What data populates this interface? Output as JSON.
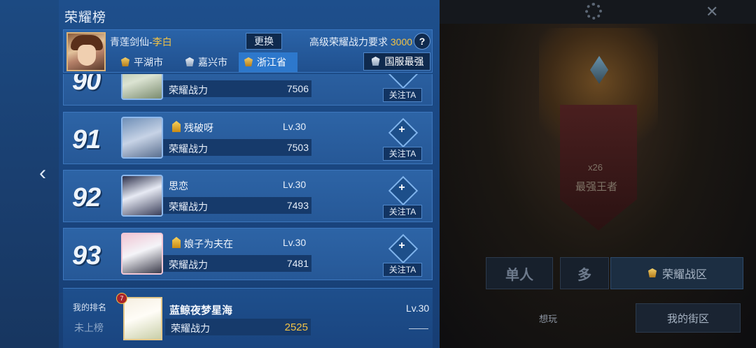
{
  "panel": {
    "title": "荣耀榜"
  },
  "header": {
    "hero_name_prefix": "青莲剑仙-",
    "hero_name_highlight": "李白",
    "swap_label": "更换",
    "requirement_label": "高级荣耀战力要求",
    "requirement_value": "3000",
    "help_label": "?",
    "tabs": [
      {
        "label": "平湖市"
      },
      {
        "label": "嘉兴市"
      },
      {
        "label": "浙江省"
      }
    ],
    "server_label": "国服最强"
  },
  "rows": [
    {
      "rank": "90",
      "name": "",
      "level": "",
      "power_label": "荣耀战力",
      "power": "7506",
      "follow_label": "关注TA"
    },
    {
      "rank": "91",
      "name": "残破呀",
      "level": "Lv.30",
      "power_label": "荣耀战力",
      "power": "7503",
      "follow_label": "关注TA"
    },
    {
      "rank": "92",
      "name": "思恋",
      "level": "Lv.30",
      "power_label": "荣耀战力",
      "power": "7493",
      "follow_label": "关注TA"
    },
    {
      "rank": "93",
      "name": "娘子为夫在",
      "level": "Lv.30",
      "power_label": "荣耀战力",
      "power": "7481",
      "follow_label": "关注TA"
    }
  ],
  "my_rank": {
    "label": "我的排名",
    "status": "未上榜",
    "badge": "7",
    "name": "蓝鲸夜梦星海",
    "level": "Lv.30",
    "power_label": "荣耀战力",
    "power": "2525",
    "rank_dash": "——"
  },
  "background": {
    "star_count": "x26",
    "tier_name": "最强王者",
    "mode_solo": "单人",
    "mode_multi": "多",
    "zone_label": "荣耀战区",
    "think_label": "想玩",
    "street_label": "我的街区"
  },
  "colors": {
    "accent_gold": "#f2c245",
    "panel_blue": "#1e4f8c",
    "active_tab": "#2d78cc"
  }
}
